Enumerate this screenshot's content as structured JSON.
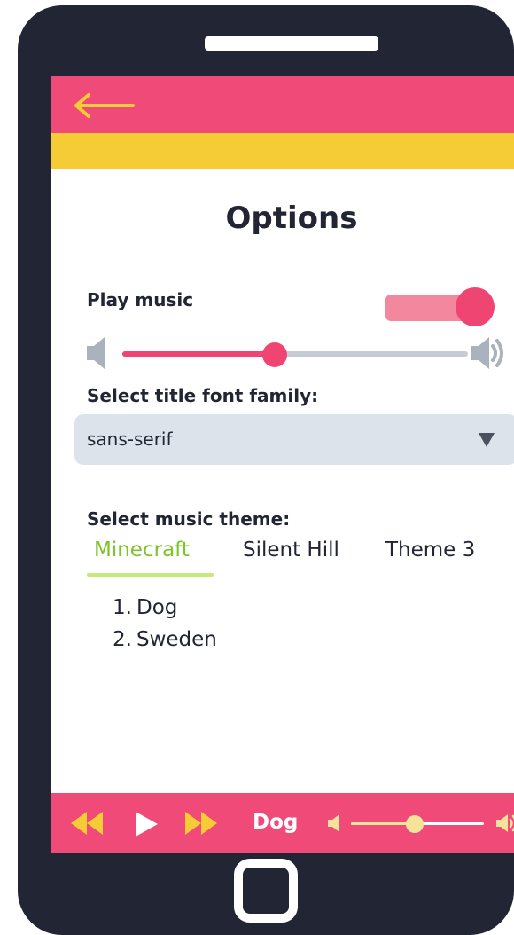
{
  "options": {
    "title": "Options",
    "play_music_label": "Play music",
    "play_music_on": true,
    "volume_level": 0.44,
    "font_label": "Select title font family:",
    "font_selected": "sans-serif",
    "theme_label": "Select music theme:",
    "tabs": [
      {
        "label": "Minecraft",
        "active": true
      },
      {
        "label": "Silent Hill",
        "active": false
      },
      {
        "label": "Theme 3",
        "active": false
      }
    ],
    "tracks": [
      {
        "number": "1.",
        "title": "Dog"
      },
      {
        "number": "2.",
        "title": "Sweden"
      }
    ]
  },
  "player": {
    "now_playing": "Dog",
    "volume_level": 0.48
  },
  "colors": {
    "header_pink": "#f04b78",
    "header_yellow": "#f5cc36",
    "accent_pink": "#ee4573",
    "tab_active": "#7cc528",
    "phone_body": "#222533"
  },
  "icons": {
    "back": "arrow-left-icon",
    "volume_low": "speaker-low-icon",
    "volume_high": "speaker-high-icon",
    "dropdown": "triangle-down-icon",
    "rewind": "rewind-icon",
    "play": "play-icon",
    "forward": "fast-forward-icon"
  }
}
